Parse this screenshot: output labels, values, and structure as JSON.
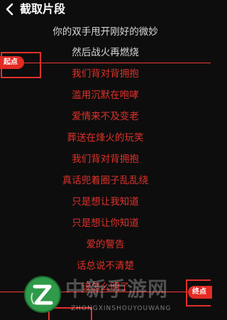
{
  "header": {
    "back_icon": "chevron-left-icon",
    "title": "截取片段"
  },
  "lyrics": [
    {
      "text": "你的双手甩开刚好的微妙",
      "color": "white"
    },
    {
      "text": "然后战火再燃烧",
      "color": "white"
    },
    {
      "text": "我们背对背拥抱",
      "color": "red"
    },
    {
      "text": "滥用沉默在咆哮",
      "color": "red"
    },
    {
      "text": "爱情来不及变老",
      "color": "red"
    },
    {
      "text": "葬送在烽火的玩笑",
      "color": "red"
    },
    {
      "text": "我们背对背拥抱",
      "color": "red"
    },
    {
      "text": "真话兜着圈子乱乱绕",
      "color": "red"
    },
    {
      "text": "只是想让我知道",
      "color": "red"
    },
    {
      "text": "只是想让你知道",
      "color": "red"
    },
    {
      "text": "爱的警告",
      "color": "red"
    },
    {
      "text": "话总说不清楚",
      "color": "red"
    },
    {
      "text": "该怎么明了",
      "color": "red"
    }
  ],
  "markers": {
    "start_label": "起点",
    "end_label": "终点"
  },
  "colors": {
    "background": "#0d0d0d",
    "accent_red": "#e0312a",
    "lyric_white": "#d9d9d9"
  },
  "watermark": {
    "logo_icon": "z-logo-icon",
    "cn": "中新手游网",
    "en": "ZHONGXINSHOUYOUWANG"
  }
}
